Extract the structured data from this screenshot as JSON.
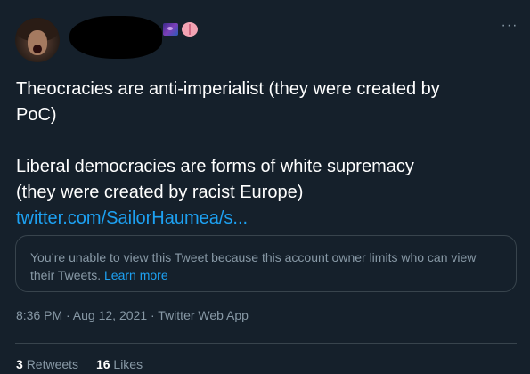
{
  "tweet": {
    "redacted_name": "",
    "body": {
      "line1": "Theocracies are anti-imperialist (they were created by",
      "line2": "PoC)",
      "line3": "Liberal democracies are forms of white supremacy",
      "line4": "(they were created by racist Europe)",
      "link": "twitter.com/SailorHaumea/s..."
    },
    "quote": {
      "text": "You’re unable to view this Tweet because this account owner limits who can view their Tweets.",
      "learn_more": "Learn more"
    },
    "meta": "8:36 PM · Aug 12, 2021 · Twitter Web App",
    "stats": {
      "retweets_count": "3",
      "retweets_label": "Retweets",
      "likes_count": "16",
      "likes_label": "Likes"
    },
    "more_label": "···",
    "icons": {
      "more": "more-icon",
      "galaxy": "galaxy-emoji",
      "brain": "brain-emoji"
    }
  }
}
